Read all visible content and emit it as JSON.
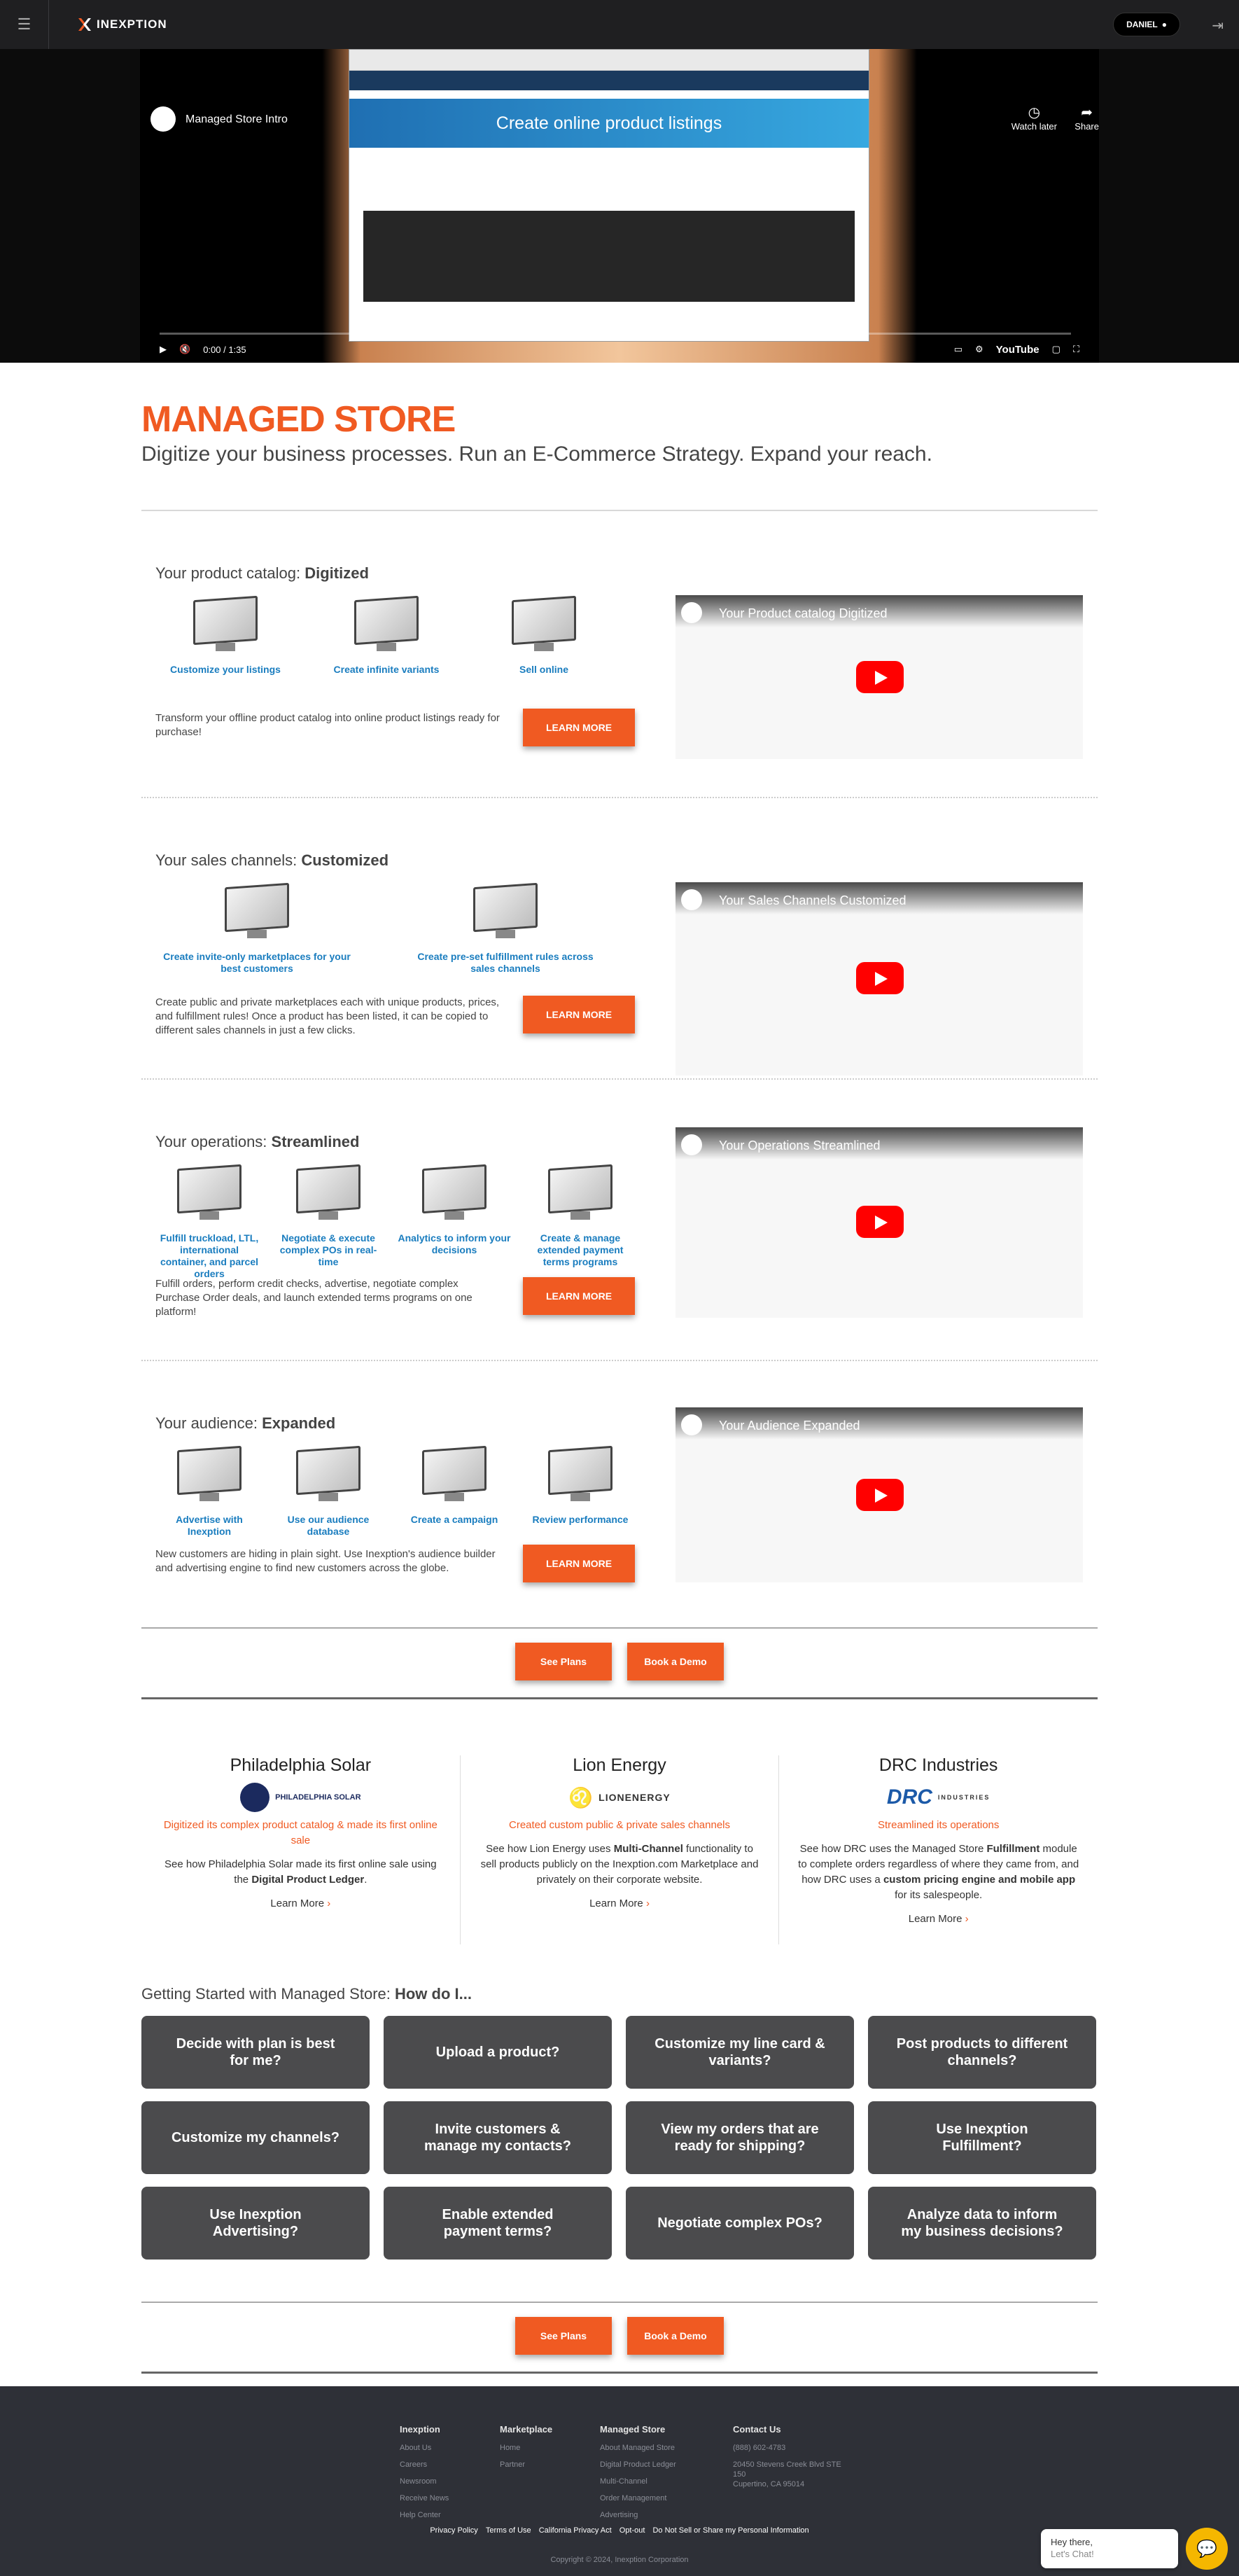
{
  "topbar": {
    "logo": "INEXPTION",
    "user": "DANIEL"
  },
  "hero": {
    "video_title": "Managed Store Intro",
    "slide_title": "Create online product listings",
    "watch_later": "Watch later",
    "share": "Share",
    "time": "0:00 / 1:35",
    "youtube": "YouTube"
  },
  "main": {
    "title": "MANAGED STORE",
    "subtitle": "Digitize your business processes. Run an E-Commerce Strategy. Expand your reach."
  },
  "sections": [
    {
      "heading_lead": "Your product catalog: ",
      "heading_bold": "Digitized",
      "features": [
        "Customize your listings",
        "Create infinite variants",
        "Sell online"
      ],
      "description": "Transform your offline product catalog into online product listings ready for purchase!",
      "button": "LEARN MORE",
      "video_title": "Your Product catalog Digitized"
    },
    {
      "heading_lead": "Your sales channels: ",
      "heading_bold": "Customized",
      "features": [
        "Create invite-only marketplaces for your best customers",
        "Create pre-set fulfillment rules across sales channels"
      ],
      "description": "Create public and private marketplaces each with unique products, prices, and fulfillment rules! Once a product has been listed, it can be copied to different sales channels in just a few clicks.",
      "button": "LEARN MORE",
      "video_title": "Your Sales Channels Customized"
    },
    {
      "heading_lead": "Your operations: ",
      "heading_bold": "Streamlined",
      "features": [
        "Fulfill truckload, LTL, international container, and parcel orders",
        "Negotiate & execute complex POs in real-time",
        "Analytics to inform your decisions",
        "Create & manage extended payment terms programs"
      ],
      "description": "Fulfill orders, perform credit checks, advertise, negotiate complex Purchase Order deals, and launch extended terms programs on one platform!",
      "button": "LEARN MORE",
      "video_title": "Your Operations Streamlined"
    },
    {
      "heading_lead": "Your audience: ",
      "heading_bold": "Expanded",
      "features": [
        "Advertise with Inexption",
        "Use our audience database",
        "Create a campaign",
        "Review performance"
      ],
      "description": "New customers are hiding in plain sight. Use Inexption's audience builder and advertising engine to find new customers across the globe.",
      "button": "LEARN MORE",
      "video_title": "Your Audience Expanded"
    }
  ],
  "cta": {
    "plans": "See Plans",
    "demo": "Book a Demo"
  },
  "cases": [
    {
      "name": "Philadelphia Solar",
      "logo": "PHILADELPHIA SOLAR",
      "highlight": "Digitized its complex product catalog & made its first online sale",
      "text_a": "See how Philadelphia Solar made its first online sale using the ",
      "text_b": "Digital Product Ledger",
      "text_c": ".",
      "link": "Learn More"
    },
    {
      "name": "Lion Energy",
      "logo": "LIONENERGY",
      "highlight": "Created custom public & private sales channels",
      "text_a": "See how Lion Energy uses ",
      "text_b": "Multi-Channel",
      "text_c": " functionality to sell products publicly on the Inexption.com Marketplace and privately on their corporate website.",
      "link": "Learn More"
    },
    {
      "name": "DRC Industries",
      "logo": "DRC",
      "logo_sub": "INDUSTRIES",
      "highlight": "Streamlined its operations",
      "text_a": "See how DRC uses the Managed Store ",
      "text_b": "Fulfillment",
      "text_c": " module to complete orders regardless of where they came from, and how DRC uses a ",
      "text_d": "custom pricing engine and mobile app",
      "text_e": " for its salespeople.",
      "link": "Learn More"
    }
  ],
  "getting_started": {
    "lead": "Getting Started with Managed Store: ",
    "bold": "How do I...",
    "items": [
      "Decide with plan is best for me?",
      "Upload a product?",
      "Customize my line card & variants?",
      "Post products to different channels?",
      "Customize my channels?",
      "Invite customers & manage my contacts?",
      "View my orders that are ready for shipping?",
      "Use Inexption Fulfillment?",
      "Use Inexption Advertising?",
      "Enable extended payment terms?",
      "Negotiate complex POs?",
      "Analyze data to inform my business decisions?"
    ]
  },
  "footer": {
    "cols": [
      {
        "title": "Inexption",
        "links": [
          "About Us",
          "Careers",
          "Newsroom",
          "Receive News",
          "Help Center"
        ]
      },
      {
        "title": "Marketplace",
        "links": [
          "Home",
          "Partner"
        ]
      },
      {
        "title": "Managed Store",
        "links": [
          "About Managed Store",
          "Digital Product Ledger",
          "Multi-Channel",
          "Order Management",
          "Advertising"
        ]
      },
      {
        "title": "Contact Us",
        "links": [
          "(888) 602-4783",
          "20450 Stevens Creek Blvd STE 150",
          "Cupertino, CA 95014"
        ]
      }
    ],
    "bottom": [
      "Privacy Policy",
      "Terms of Use",
      "California Privacy Act",
      "Opt-out",
      "Do Not Sell or Share my Personal Information"
    ],
    "copyright": "Copyright © 2024, Inexption Corporation"
  },
  "chat": {
    "line1": "Hey there,",
    "line2": "Let's Chat!"
  },
  "colors": {
    "accent": "#f05a22",
    "link": "#1a7dbf",
    "dark": "#1f1f21",
    "card": "#4b4b4d",
    "footer": "#2e3037"
  }
}
